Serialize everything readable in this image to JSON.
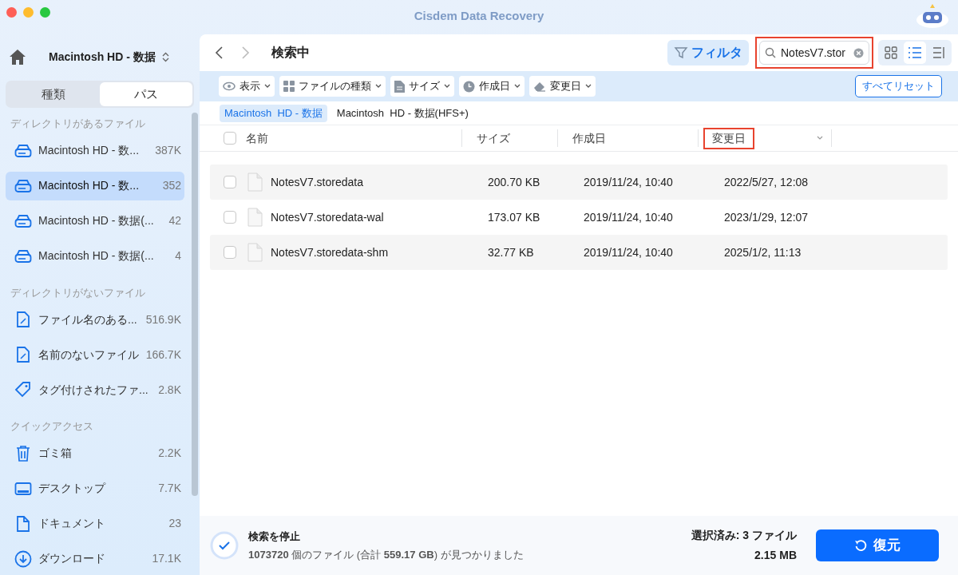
{
  "window": {
    "title": "Cisdem Data Recovery"
  },
  "sidebar": {
    "drive": "Macintosh  HD - 数据",
    "tabs": [
      {
        "label": "種類",
        "selected": false
      },
      {
        "label": "パス",
        "selected": true
      }
    ],
    "sections": [
      {
        "title": "ディレクトリがあるファイル",
        "items": [
          {
            "kind": "drive",
            "label": "Macintosh  HD - 数...",
            "count": "387K",
            "selected": false
          },
          {
            "kind": "drive",
            "label": "Macintosh  HD - 数...",
            "count": "352",
            "selected": true
          },
          {
            "kind": "drive",
            "label": "Macintosh  HD - 数据(...",
            "count": "42",
            "selected": false
          },
          {
            "kind": "drive",
            "label": "Macintosh  HD - 数据(...",
            "count": "4",
            "selected": false
          }
        ]
      },
      {
        "title": "ディレクトリがないファイル",
        "items": [
          {
            "kind": "file",
            "label": "ファイル名のある...",
            "count": "516.9K",
            "selected": false
          },
          {
            "kind": "file",
            "label": "名前のないファイル",
            "count": "166.7K",
            "selected": false
          },
          {
            "kind": "tag",
            "label": "タグ付けされたファ...",
            "count": "2.8K",
            "selected": false
          }
        ]
      },
      {
        "title": "クイックアクセス",
        "items": [
          {
            "kind": "trash",
            "label": "ゴミ箱",
            "count": "2.2K",
            "selected": false
          },
          {
            "kind": "desktop",
            "label": "デスクトップ",
            "count": "7.7K",
            "selected": false
          },
          {
            "kind": "document",
            "label": "ドキュメント",
            "count": "23",
            "selected": false
          },
          {
            "kind": "download",
            "label": "ダウンロード",
            "count": "17.1K",
            "selected": false
          }
        ]
      }
    ]
  },
  "toolbar": {
    "title": "検索中",
    "filter_button": "フィルタ",
    "search": {
      "value": "NotesV7.stor",
      "highlighted": true
    },
    "views": [
      {
        "kind": "grid",
        "selected": false
      },
      {
        "kind": "list",
        "selected": true
      },
      {
        "kind": "columns",
        "selected": false
      }
    ]
  },
  "filters": [
    {
      "kind": "eye",
      "label": "表示"
    },
    {
      "kind": "grid",
      "label": "ファイルの種類"
    },
    {
      "kind": "doc",
      "label": "サイズ"
    },
    {
      "kind": "clock",
      "label": "作成日"
    },
    {
      "kind": "eraser",
      "label": "変更日"
    }
  ],
  "reset_button": "すべてリセット",
  "breadcrumbs": [
    {
      "label": "Macintosh  HD - 数据",
      "selected": true
    },
    {
      "label": "Macintosh  HD - 数据(HFS+)",
      "selected": false
    }
  ],
  "table": {
    "select_all_checked": false,
    "columns": [
      {
        "label": "名前",
        "highlighted": false
      },
      {
        "label": "サイズ",
        "highlighted": false
      },
      {
        "label": "作成日",
        "highlighted": false
      },
      {
        "label": "変更日",
        "highlighted": true
      }
    ],
    "rows": [
      {
        "checked": false,
        "name": "NotesV7.storedata",
        "size": "200.70 KB",
        "created": "2019/11/24, 10:40",
        "modified": "2022/5/27, 12:08"
      },
      {
        "checked": false,
        "name": "NotesV7.storedata-wal",
        "size": "173.07 KB",
        "created": "2019/11/24, 10:40",
        "modified": "2023/1/29, 12:07"
      },
      {
        "checked": false,
        "name": "NotesV7.storedata-shm",
        "size": "32.77 KB",
        "created": "2019/11/24, 10:40",
        "modified": "2025/1/2, 11:13"
      }
    ]
  },
  "status_bar": {
    "title": "検索を停止",
    "summary": "**1073720** 個のファイル (合計 **559.17 GB**) が見つかりました",
    "selected": "選択済み: 3 ファイル",
    "selected_size": "2.15 MB",
    "recover_button": "復元"
  }
}
